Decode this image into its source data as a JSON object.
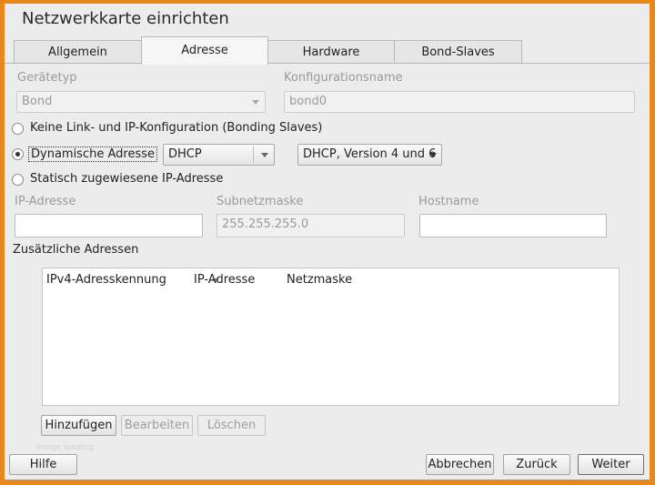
{
  "window": {
    "title": "Netzwerkkarte einrichten"
  },
  "tabs": [
    {
      "label": "Allgemein",
      "active": false
    },
    {
      "label": "Adresse",
      "active": true
    },
    {
      "label": "Hardware",
      "active": false
    },
    {
      "label": "Bond-Slaves",
      "active": false
    }
  ],
  "device": {
    "type_label": "Gerätetyp",
    "type_value": "Bond",
    "config_name_label": "Konfigurationsname",
    "config_name_value": "bond0"
  },
  "address_mode": {
    "options": [
      {
        "label": "Keine Link- und IP-Konfiguration (Bonding Slaves)",
        "selected": false
      },
      {
        "label": "Dynamische Adresse",
        "selected": true
      },
      {
        "label": "Statisch zugewiesene IP-Adresse",
        "selected": false
      }
    ],
    "dynamic_method_value": "DHCP",
    "dhcp_version_value": "DHCP, Version 4 und 6"
  },
  "static": {
    "ip_label": "IP-Adresse",
    "ip_value": "",
    "netmask_label": "Subnetzmaske",
    "netmask_value": "255.255.255.0",
    "hostname_label": "Hostname",
    "hostname_value": ""
  },
  "additional": {
    "section_title": "Zusätzliche Adressen",
    "columns": [
      "IPv4-Adresskennung",
      "IP-Adresse",
      "Netzmaske"
    ],
    "rows": [],
    "add_label": "Hinzufügen",
    "edit_label": "Bearbeiten",
    "delete_label": "Löschen"
  },
  "footer": {
    "help_label": "Hilfe",
    "cancel_label": "Abbrechen",
    "back_label": "Zurück",
    "next_label": "Weiter",
    "faint_text": "image loading"
  },
  "colors": {
    "frame": "#e8881a",
    "dialog_bg": "#ececec"
  }
}
